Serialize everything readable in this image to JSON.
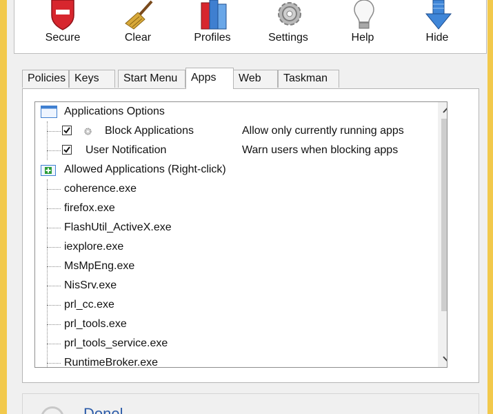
{
  "toolbar": {
    "buttons": [
      {
        "label": "Secure",
        "icon": "shield-icon"
      },
      {
        "label": "Clear",
        "icon": "broom-icon"
      },
      {
        "label": "Profiles",
        "icon": "profiles-icon"
      },
      {
        "label": "Settings",
        "icon": "gear-icon"
      },
      {
        "label": "Help",
        "icon": "lightbulb-icon"
      },
      {
        "label": "Hide",
        "icon": "hide-arrow-icon"
      }
    ]
  },
  "tabs": [
    {
      "label": "Policies"
    },
    {
      "label": "Keys"
    },
    {
      "label": "Start Menu"
    },
    {
      "label": "Apps",
      "active": true
    },
    {
      "label": "Web"
    },
    {
      "label": "Taskman"
    }
  ],
  "tree": {
    "options_group": {
      "label": "Applications Options",
      "items": [
        {
          "label": "Block Applications",
          "checked": true,
          "description": "Allow only currently running apps"
        },
        {
          "label": "User Notification",
          "checked": true,
          "description": "Warn users when blocking apps"
        }
      ]
    },
    "allowed_group": {
      "label": "Allowed Applications (Right-click)",
      "apps": [
        "coherence.exe",
        "firefox.exe",
        "FlashUtil_ActiveX.exe",
        "iexplore.exe",
        "MsMpEng.exe",
        "NisSrv.exe",
        "prl_cc.exe",
        "prl_tools.exe",
        "prl_tools_service.exe",
        "RuntimeBroker.exe"
      ]
    }
  },
  "footer": {
    "label": "Donel"
  },
  "colors": {
    "frame": "#f2c94c",
    "shield_red": "#d7262e",
    "link_blue": "#2a5aa8",
    "check_group_blue": "#3f7fd0",
    "add_green": "#2e9e3a"
  }
}
